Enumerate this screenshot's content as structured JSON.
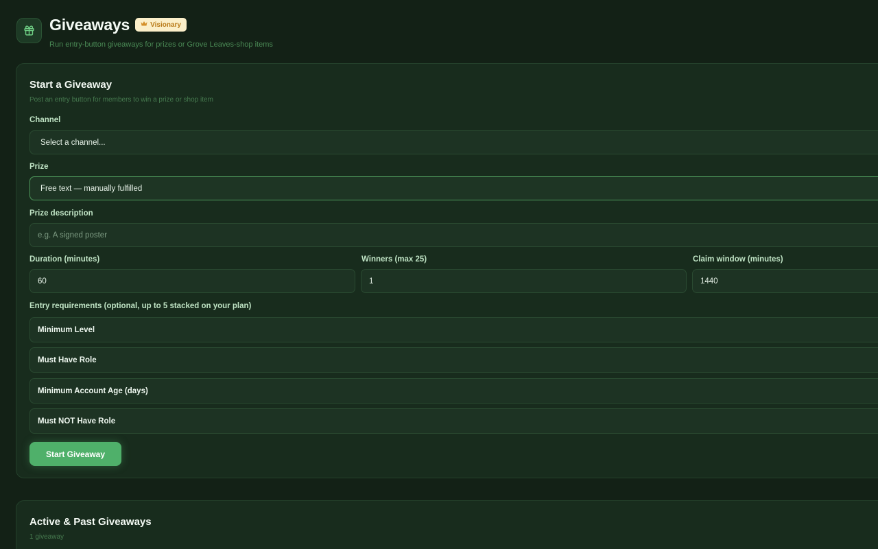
{
  "header": {
    "title": "Giveaways",
    "badge": "Visionary",
    "subtitle": "Run entry-button giveaways for prizes or Grove Leaves-shop items"
  },
  "form": {
    "title": "Start a Giveaway",
    "subtitle": "Post an entry button for members to win a prize or shop item",
    "channel_label": "Channel",
    "channel_value": "Select a channel...",
    "prize_label": "Prize",
    "prize_value": "Free text — manually fulfilled",
    "prize_desc_label": "Prize description",
    "prize_desc_placeholder": "e.g. A signed poster",
    "duration_label": "Duration (minutes)",
    "duration_value": "60",
    "winners_label": "Winners (max 25)",
    "winners_value": "1",
    "claim_label": "Claim window (minutes)",
    "claim_value": "1440",
    "requirements_label": "Entry requirements (optional, up to 5 stacked on your plan)",
    "requirements": [
      {
        "label": "Minimum Level"
      },
      {
        "label": "Must Have Role"
      },
      {
        "label": "Minimum Account Age (days)"
      },
      {
        "label": "Must NOT Have Role"
      }
    ],
    "submit_label": "Start Giveaway"
  },
  "list": {
    "title": "Active & Past Giveaways",
    "count": "1 giveaway"
  },
  "colors": {
    "background": "#132116",
    "card": "#182c1d",
    "accent": "#4fb06a",
    "badge_bg": "#fbefc9",
    "badge_text": "#b87a18"
  },
  "icons": {
    "header": "gift-icon",
    "badge": "crown-icon"
  }
}
